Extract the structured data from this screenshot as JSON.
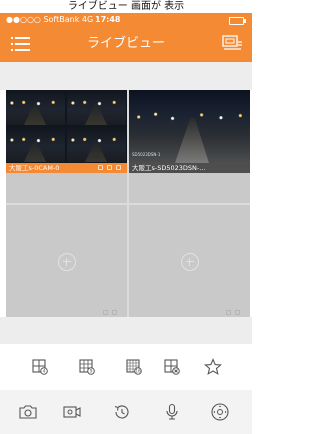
{
  "top_caption": "ライブビュー 画面が 表示",
  "status": {
    "carrier": "●●○○○ SoftBank  4G",
    "time": "17:48"
  },
  "nav": {
    "title": "ライブビュー"
  },
  "cameras": [
    {
      "label": "大阪工s-0CAM-0",
      "selected": true,
      "osd": ""
    },
    {
      "label": "大阪工s-SD5023DSN-...",
      "selected": false,
      "osd": "SD5023DSN-1"
    }
  ],
  "layout_icons": [
    "grid-4-icon",
    "grid-9-icon",
    "grid-16-icon",
    "grid-close-icon",
    "star-icon"
  ],
  "control_icons": [
    "snapshot-icon",
    "record-icon",
    "playback-icon",
    "microphone-icon",
    "ptz-icon"
  ],
  "colors": {
    "accent": "#f58a35",
    "label_inactive": "#4e4e4e"
  }
}
